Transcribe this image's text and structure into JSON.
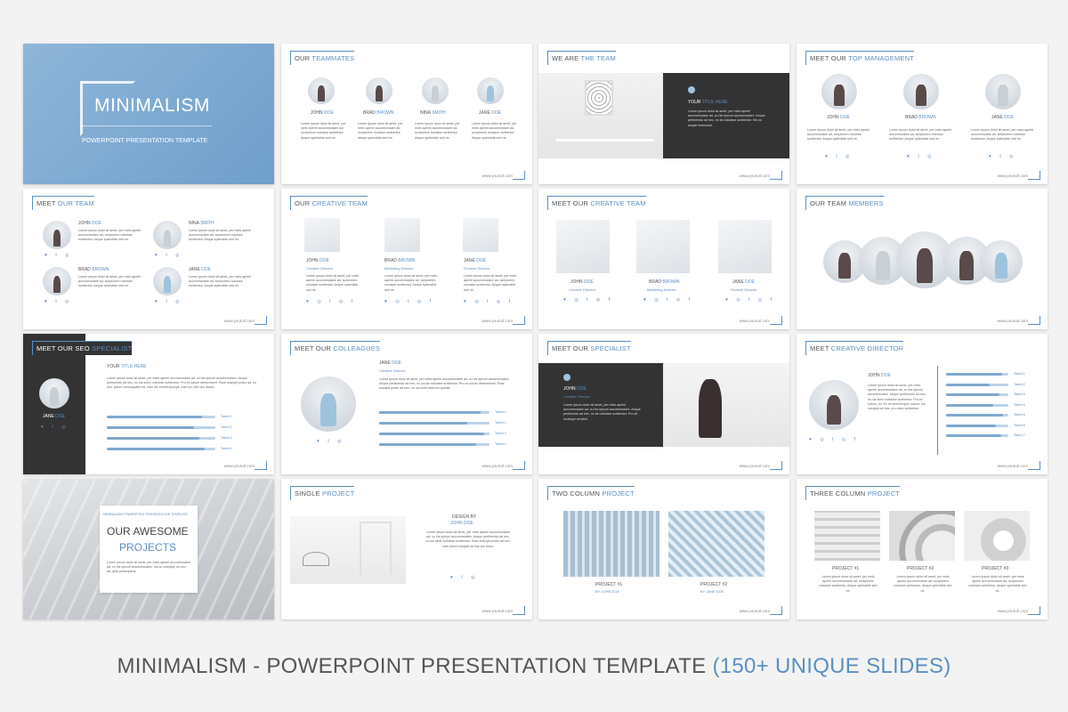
{
  "url_text": "www.yoururl.com",
  "lorem": "Lorem ipsum dolor sit amet, per mels aperiri accommodare ad, scriptorem noluisse scribentur. Aeque splendide sed ne.",
  "social_icons": "♥ t ◎",
  "social_icons_long": "♥ ◎ t ◎ f",
  "slides": [
    {
      "title_dark": "",
      "title_hl": "",
      "cover_title": "MINIMALISM",
      "cover_subtitle": "POWERPOINT PRESENTATION TEMPLATE"
    },
    {
      "title_dark": "OUR ",
      "title_hl": "TEAMMATES",
      "people": [
        [
          "JOHN ",
          "DOE"
        ],
        [
          "BRAD ",
          "BROWN"
        ],
        [
          "NINA ",
          "SMITH"
        ],
        [
          "JANE ",
          "DOE"
        ]
      ]
    },
    {
      "title_dark": "WE ARE ",
      "title_hl": "THE TEAM",
      "heading_dark": "YOUR ",
      "heading_hl": "TITLE HERE",
      "body": "Lorem ipsum dolor sit amet, per mels aperiri accommodare ad, cu his epicuri accommodare. Aeque pertinendo ad nec, no sit nolluisse scribentur. His no simple interesset."
    },
    {
      "title_dark": "MEET OUR ",
      "title_hl": "TOP MANAGEMENT",
      "people": [
        [
          "JOHN ",
          "DOE"
        ],
        [
          "BRAD ",
          "BROWN"
        ],
        [
          "JANE ",
          "DOE"
        ]
      ]
    },
    {
      "title_dark": "MEET ",
      "title_hl": "OUR TEAM",
      "people": [
        [
          "JOHN ",
          "DOE"
        ],
        [
          "NINA ",
          "SMITH"
        ],
        [
          "BRAD ",
          "BROWN"
        ],
        [
          "JANE ",
          "DOE"
        ]
      ]
    },
    {
      "title_dark": "OUR ",
      "title_hl": "CREATIVE TEAM",
      "people": [
        [
          "JOHN ",
          "DOE",
          "Creative Director"
        ],
        [
          "BRAD ",
          "BROWN",
          "Marketing Director"
        ],
        [
          "JANE ",
          "DOE",
          "Finance Director"
        ]
      ]
    },
    {
      "title_dark": "MEET OUR ",
      "title_hl": "CREATIVE TEAM",
      "people": [
        [
          "JOHN ",
          "DOE",
          "Creative Director"
        ],
        [
          "BRAD ",
          "BROWN",
          "Marketing Director"
        ],
        [
          "JANE ",
          "DOE",
          "Finance Director"
        ]
      ]
    },
    {
      "title_dark": "OUR TEAM ",
      "title_hl": "MEMBERS"
    },
    {
      "title_dark": "MEET OUR SEO ",
      "title_hl": "SPECIALIST",
      "heading_dark": "YOUR ",
      "heading_hl": "TITLE HERE",
      "person": [
        "JANE ",
        "DOE"
      ],
      "body": "Lorem ipsum dolor sit amet, per mels aperiri accommodare ad, cu his epicuri accommodare. Aeque pertinendo ad nec, no ius simil, nolluisse scribentur. Pro ex solum deterruisset. Esse suscipit probo ad, cu sim. Ipsum consequatur ea, nam his eruditi suscipit, eam no, vim sed dicant.",
      "bars": [
        {
          "label": "Talent 1",
          "fill": 0.88
        },
        {
          "label": "Talent 2",
          "fill": 0.8
        },
        {
          "label": "Talent 3",
          "fill": 0.85
        },
        {
          "label": "Talent 4",
          "fill": 0.9
        }
      ]
    },
    {
      "title_dark": "MEET OUR ",
      "title_hl": "COLLEAGUES",
      "person": [
        "JANE ",
        "DOE"
      ],
      "role": "Creative Director",
      "body": "Lorem ipsum dolor sit amet, per mels aperiri accommodare ad, cu his epicuri accommodare. Aeque pertinendo ad nec, no ius sit nolluisse scribentur. Pro ex solum deterruisset. Esse suscipit probo ad nec, no ius simil dolorum quodsi.",
      "bars": [
        {
          "label": "Talent 1",
          "fill": 0.92
        },
        {
          "label": "Talent 2",
          "fill": 0.8
        },
        {
          "label": "Talent 3",
          "fill": 0.95
        },
        {
          "label": "Talent 4",
          "fill": 0.88
        }
      ]
    },
    {
      "title_dark": "MEET OUR ",
      "title_hl": "SPECIALIST",
      "person": [
        "JOHN ",
        "DOE"
      ],
      "role": "Creative Director",
      "body": "Lorem ipsum dolor sit amet, per mels aperiri accommodare ad, cu his epicuri accommodare. Aeque pertinendo ad nec, no sit nolluisse scribentur. Pro sit recteque sentiret."
    },
    {
      "title_dark": "MEET ",
      "title_hl": "CREATIVE DIRECTOR",
      "person": [
        "JOHN ",
        "DOE"
      ],
      "body": "Lorem ipsum dolor sit amet, per mels aperiri accommodare ad, cu his epicuri accommodare. Aeque pertinendo ad nec, no ius simil nolluisse scribentur. Pro ex solum, no. Ex sit simil tempor, solum. Ius volutpat ad has, pro dolor scribentur.",
      "bars": [
        {
          "label": "Talent 1",
          "fill": 0.9
        },
        {
          "label": "Talent 2",
          "fill": 0.7
        },
        {
          "label": "Talent 3",
          "fill": 0.85
        },
        {
          "label": "Talent 4",
          "fill": 0.75
        },
        {
          "label": "Talent 5",
          "fill": 0.92
        },
        {
          "label": "Talent 6",
          "fill": 0.8
        },
        {
          "label": "Talent 7",
          "fill": 0.88
        }
      ]
    },
    {
      "title_dark": "",
      "title_hl": "",
      "kicker": "MINIMALISM POWERPOINT PRESENTATION TEMPLATE",
      "heading_dark": "OUR AWESOME",
      "heading_hl": "PROJECTS",
      "body": "Lorem ipsum dolor sit amet, per mels aperiri accommodare ad, cu his epicuri accommodare. Ius an volutpat, no nec ad, quis persequeris."
    },
    {
      "title_dark": "SINGLE ",
      "title_hl": "PROJECT",
      "heading_dark": "DESIGN BY",
      "heading_hl": "JOHN DOE",
      "body": "Lorem ipsum dolor sit amet, per mels aperiri accommodare ad, cu his epicuri accommodare. Aeque pertinendo ad nec, no ius simil nolluisse scribentur. Esse suscipit probo ad nec, mes simul volutpat ad has pro dolor."
    },
    {
      "title_dark": "TWO COLUMN ",
      "title_hl": "PROJECT",
      "projects": [
        [
          "PROJECT #1",
          "BY JOHN DOE"
        ],
        [
          "PROJECT #2",
          "BY JANE DOE"
        ]
      ]
    },
    {
      "title_dark": "THREE COLUMN ",
      "title_hl": "PROJECT",
      "projects": [
        [
          "PROJECT #1"
        ],
        [
          "PROJECT #2"
        ],
        [
          "PROJECT #3"
        ]
      ]
    }
  ],
  "caption": {
    "main": "MINIMALISM - POWERPOINT PRESENTATION TEMPLATE ",
    "accent": "(150+ UNIQUE SLIDES)"
  }
}
